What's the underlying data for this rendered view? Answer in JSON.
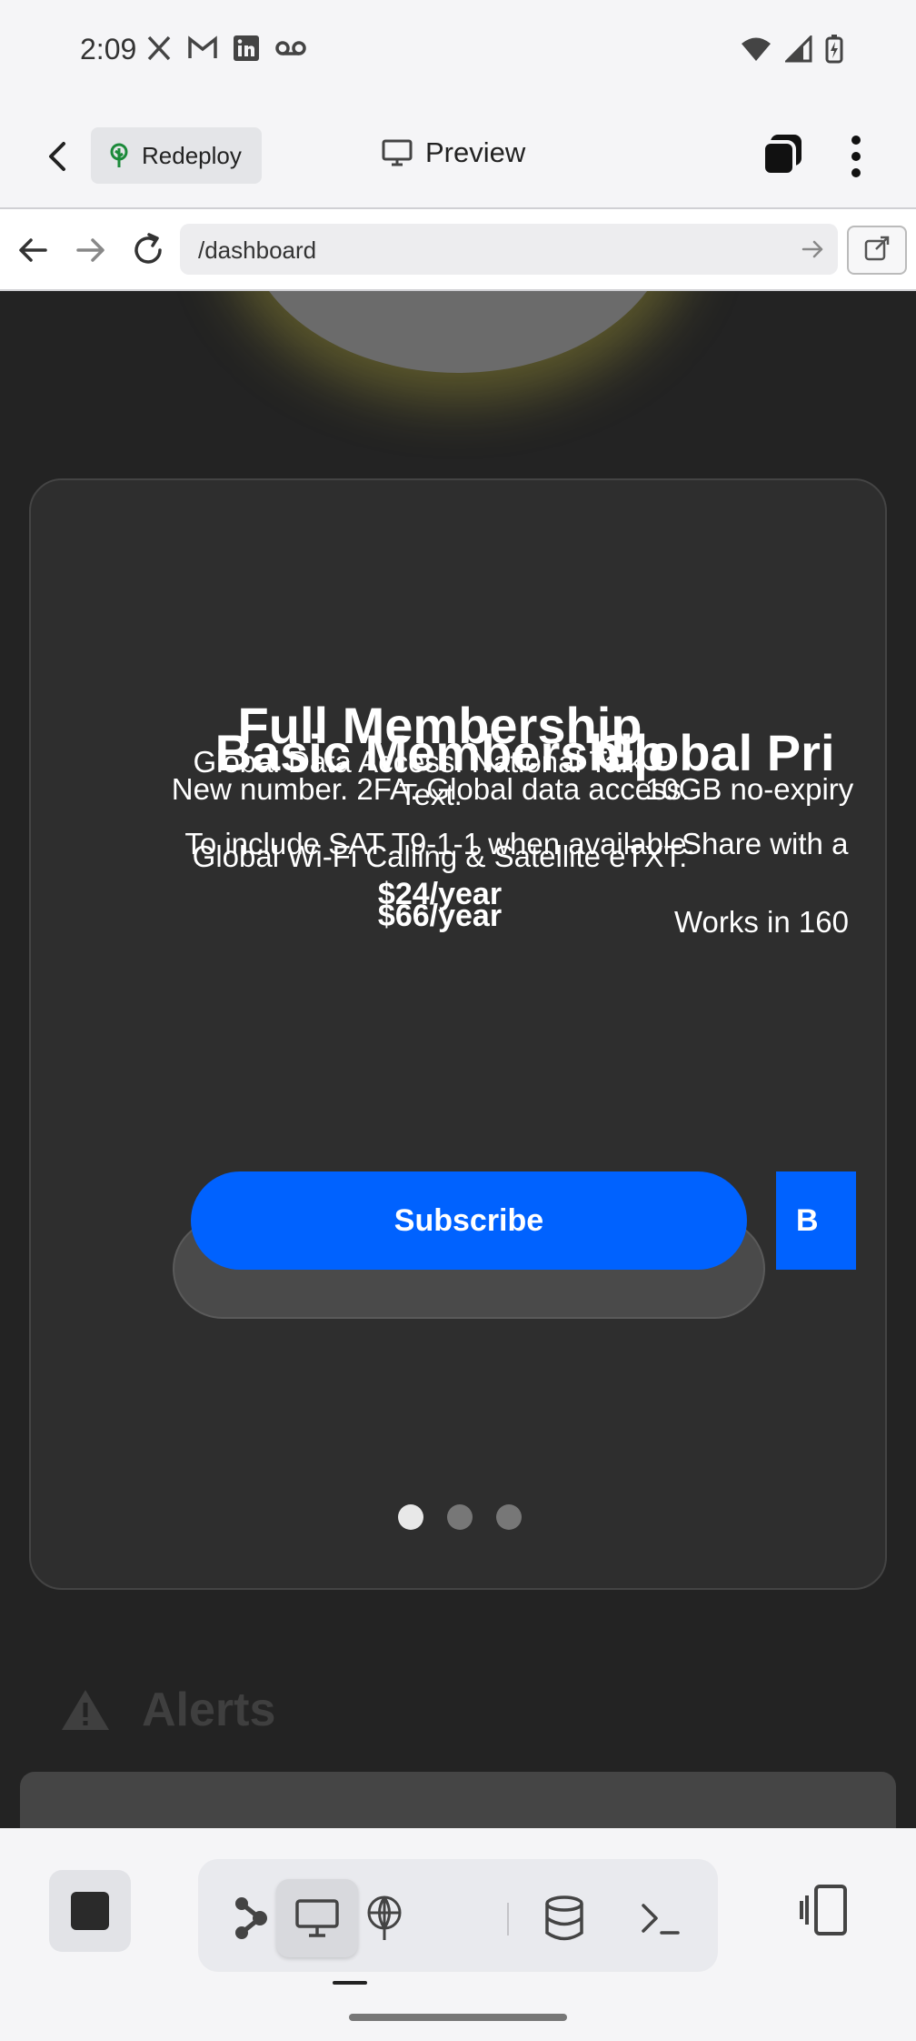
{
  "status_bar": {
    "time": "2:09",
    "left_icons": [
      "x-logo-icon",
      "gmail-icon",
      "linkedin-icon",
      "voicemail-icon"
    ],
    "right_icons": [
      "wifi-icon",
      "signal-icon",
      "battery-charging-icon"
    ]
  },
  "header": {
    "redeploy_label": "Redeploy",
    "preview_label": "Preview"
  },
  "browser": {
    "url": "/dashboard"
  },
  "carousel": {
    "slides": [
      {
        "title": "Full Membership",
        "description": "Global Data Access. National Talk + Text.",
        "feature": "Global Wi-Fi Calling & Satellite eTXT.",
        "price": "$66/year"
      },
      {
        "title": "Basic Membership",
        "description": "New number. 2FA. Global data access.",
        "feature": "To include SAT T9-1-1 when available.",
        "price": "$24/year"
      },
      {
        "title": "Global Pri",
        "description": "10GB no-expiry",
        "feature": "Share with a",
        "extra": "Works in 160"
      }
    ],
    "subscribe_label": "Subscribe",
    "next_button_label": "B",
    "dots_total": 3,
    "active_dot": 1
  },
  "alerts": {
    "label": "Alerts"
  },
  "colors": {
    "accent": "#0062ff",
    "background": "#232323",
    "card": "#2e2e2e"
  }
}
